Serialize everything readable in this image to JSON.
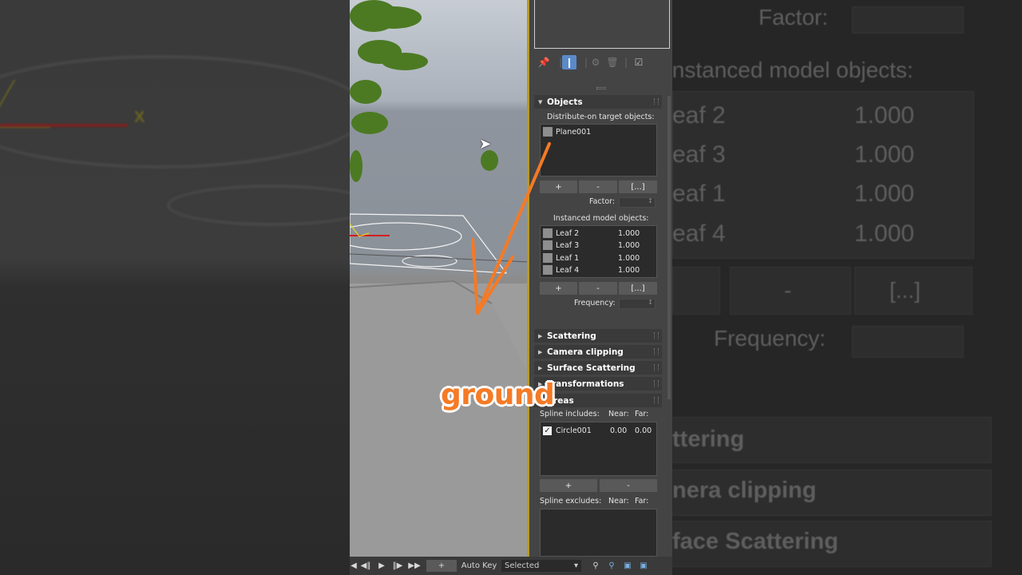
{
  "background_right": {
    "factor_label": "Factor:",
    "instanced_label": "Instanced model objects:",
    "rows": [
      {
        "name": "eaf 2",
        "value": "1.000"
      },
      {
        "name": "eaf 3",
        "value": "1.000"
      },
      {
        "name": "eaf 1",
        "value": "1.000"
      },
      {
        "name": "eaf 4",
        "value": "1.000"
      }
    ],
    "minus": "-",
    "more": "[...]",
    "frequency_label": "Frequency:",
    "rollouts": [
      "ttering",
      "nera clipping",
      "face Scattering"
    ]
  },
  "viewport": {
    "axis_x": "X"
  },
  "panel": {
    "objects": {
      "title": "Objects",
      "distribute_label": "Distribute-on target objects:",
      "targets": [
        "Plane001"
      ],
      "add": "+",
      "remove": "-",
      "more": "[...]",
      "factor_label": "Factor:",
      "instanced_label": "Instanced model objects:",
      "instanced": [
        {
          "name": "Leaf 2",
          "value": "1.000"
        },
        {
          "name": "Leaf 3",
          "value": "1.000"
        },
        {
          "name": "Leaf 1",
          "value": "1.000"
        },
        {
          "name": "Leaf 4",
          "value": "1.000"
        }
      ],
      "frequency_label": "Frequency:"
    },
    "rollouts": {
      "scattering": "Scattering",
      "camera_clipping": "Camera clipping",
      "surface_scattering": "Surface Scattering",
      "transformations": "Transformations",
      "areas": "Areas"
    },
    "areas": {
      "spline_includes": "Spline includes:",
      "near": "Near:",
      "far": "Far:",
      "include_rows": [
        {
          "name": "Circle001",
          "near": "0.00",
          "far": "0.00",
          "checked": true
        }
      ],
      "add": "+",
      "remove": "-",
      "spline_excludes": "Spline excludes:"
    }
  },
  "bottombar": {
    "auto_key": "Auto Key",
    "selection": "Selected"
  },
  "overlay": {
    "caption": "ground"
  }
}
